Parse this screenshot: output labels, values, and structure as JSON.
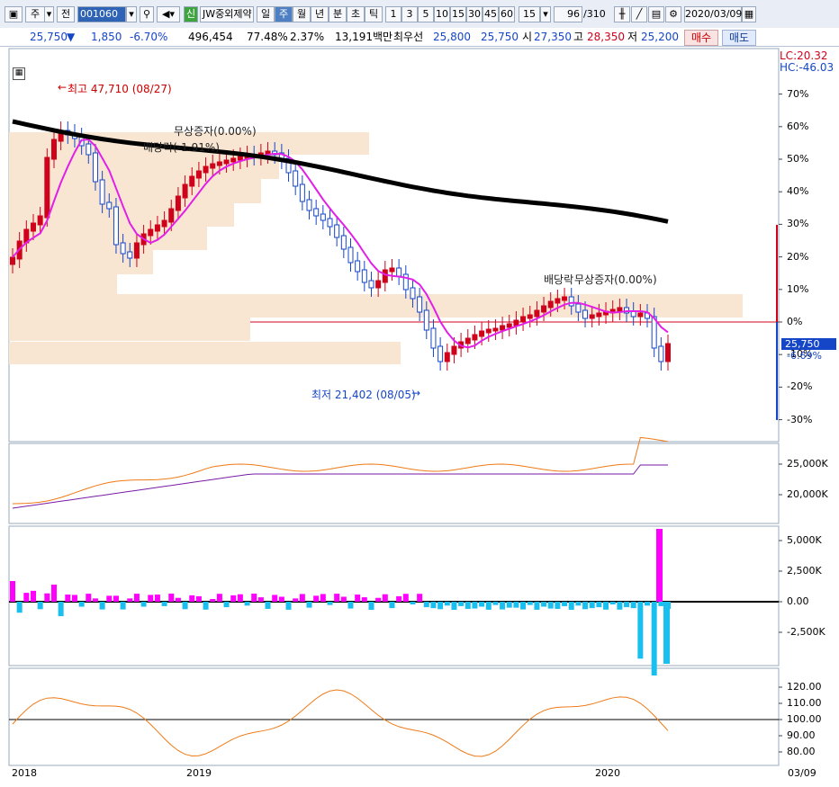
{
  "toolbar": {
    "type_label": "주",
    "all_label": "전",
    "code": "001060",
    "market_badge": "신",
    "stock_name": "JW중외제약",
    "period_buttons": [
      "일",
      "주",
      "월",
      "년",
      "분",
      "초",
      "틱"
    ],
    "interval_buttons": [
      "1",
      "3",
      "5",
      "10",
      "15",
      "30",
      "45",
      "60"
    ],
    "interval_select": "15",
    "count": "96",
    "total": "/310",
    "date": "2020/03/09"
  },
  "info": {
    "price": "25,750",
    "change": "1,850",
    "change_pct": "-6.70%",
    "volume": "496,454",
    "vol_ratio": "77.48%",
    "turnover": "2.37%",
    "amount": "13,191백만",
    "best_label": "최우선",
    "ask": "25,800",
    "bid": "25,750",
    "open_label": "시",
    "open": "27,350",
    "high_label": "고",
    "high": "28,350",
    "low_label": "저",
    "low": "25,200",
    "buy_label": "매수",
    "sell_label": "매도"
  },
  "main_chart": {
    "lc": "LC:20.32",
    "hc": "HC:-46.03",
    "y_ticks": [
      "70%",
      "60%",
      "50%",
      "40%",
      "30%",
      "20%",
      "10%",
      "0%",
      "-10%",
      "-20%",
      "-30%"
    ],
    "current_label": "25,750",
    "current_pct": "-6.69%",
    "high_note": "최고 47,710 (08/27)",
    "low_note": "최저 21,402 (08/05)",
    "ann_1": "무상증자(0.00%)",
    "ann_2": "배당락(-1.91%)",
    "ann_3": "배당락",
    "ann_4": "무상증자(0.00%)"
  },
  "panel2": {
    "ticks": [
      "25,000K",
      "20,000K"
    ]
  },
  "panel3": {
    "ticks": [
      "5,000K",
      "2,500K",
      "0.00",
      "-2,500K"
    ]
  },
  "panel4": {
    "ticks": [
      "120.00",
      "110.00",
      "100.00",
      "90.00",
      "80.00"
    ]
  },
  "x_axis": {
    "labels": [
      "2018",
      "2019",
      "2020"
    ],
    "last_date": "03/09"
  },
  "colors": {
    "up": "#d0021b",
    "down": "#1646c8",
    "ma20": "#e21fe6",
    "ma_long": "#000000",
    "band": "#f8e6d2",
    "pos_bar": "#ff00ff",
    "neg_bar": "#19c0ef",
    "osc": "#ef7a16"
  }
}
